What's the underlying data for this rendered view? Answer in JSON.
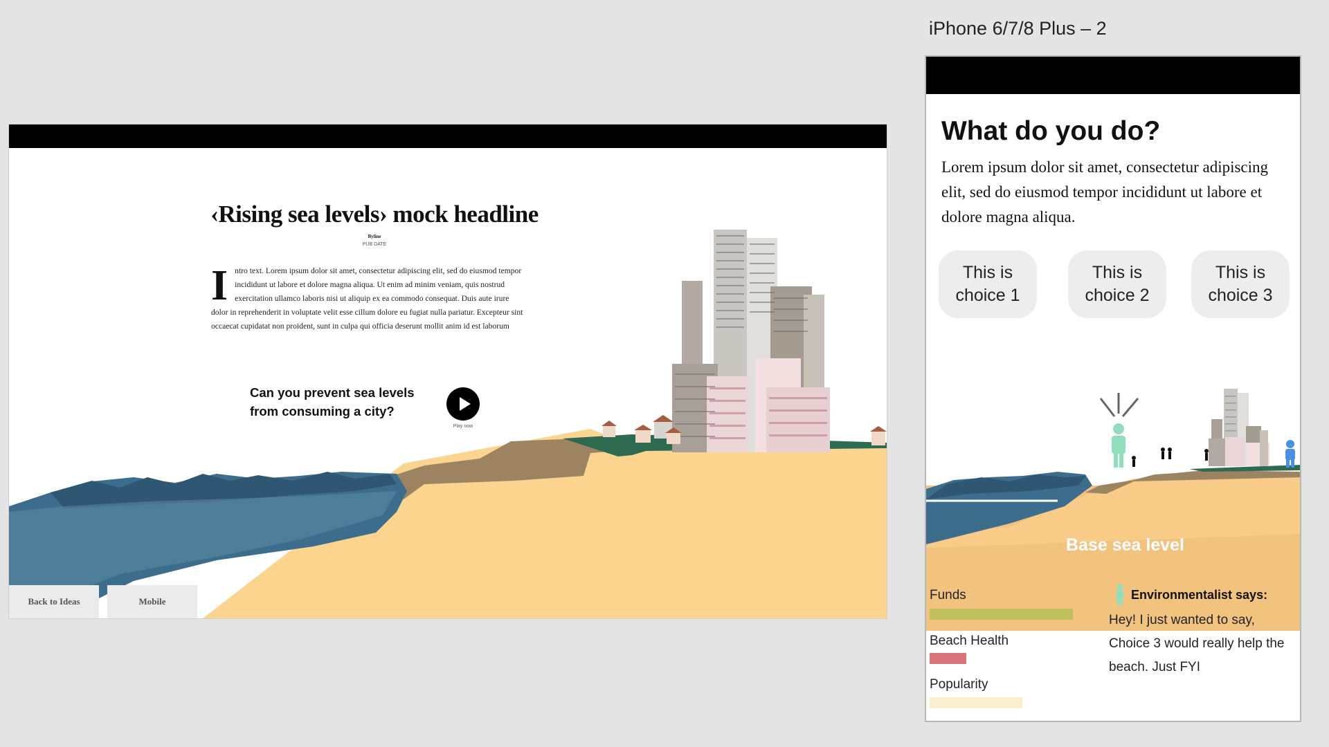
{
  "artboard": {
    "title": "iPhone 6/7/8 Plus – 2"
  },
  "desktop": {
    "headline": "‹Rising sea levels› mock headline",
    "byline": "Byline",
    "pub_date": "PUB DATE",
    "intro_dropcap": "I",
    "intro_text": "ntro text. Lorem ipsum dolor sit amet, consectetur adipiscing elit, sed do eiusmod tempor incididunt ut labore et dolore magna aliqua. Ut enim ad minim veniam, quis nostrud exercitation ullamco laboris nisi ut aliquip ex ea commodo consequat. Duis aute irure dolor in reprehenderit in voluptate velit esse cillum dolore eu fugiat nulla pariatur. Excepteur sint occaecat cupidatat non proident, sunt in culpa qui officia deserunt mollit anim id est laborum",
    "question": "Can you prevent sea levels from consuming a city?",
    "play_label": "Play now",
    "back_button": "Back to Ideas",
    "mobile_button": "Mobile"
  },
  "phone": {
    "title": "What do you do?",
    "body": "Lorem ipsum dolor sit amet, consectetur adipiscing elit, sed do  eiusmod tempor incididunt ut labore et dolore magna aliqua.",
    "choices": [
      "This is choice 1",
      "This is choice 2",
      "This is choice 3"
    ],
    "sea_level_label": "Base sea level",
    "stats": [
      {
        "label": "Funds",
        "level": 0.82,
        "color": "#bfc15f"
      },
      {
        "label": "Beach Health",
        "level": 0.21,
        "color": "#d9737a"
      },
      {
        "label": "Popularity",
        "level": 0.53,
        "color": "#fbefd2"
      }
    ],
    "advisor_title": "Environmentalist says:",
    "advisor_text": "Hey! I just wanted to say, Choice 3 would really help the beach. Just FYI"
  },
  "colors": {
    "sand": "#fbd490",
    "sea": "#3d6d8c",
    "environmentalist": "#8fdfbf",
    "panel": "#f2c27f"
  }
}
